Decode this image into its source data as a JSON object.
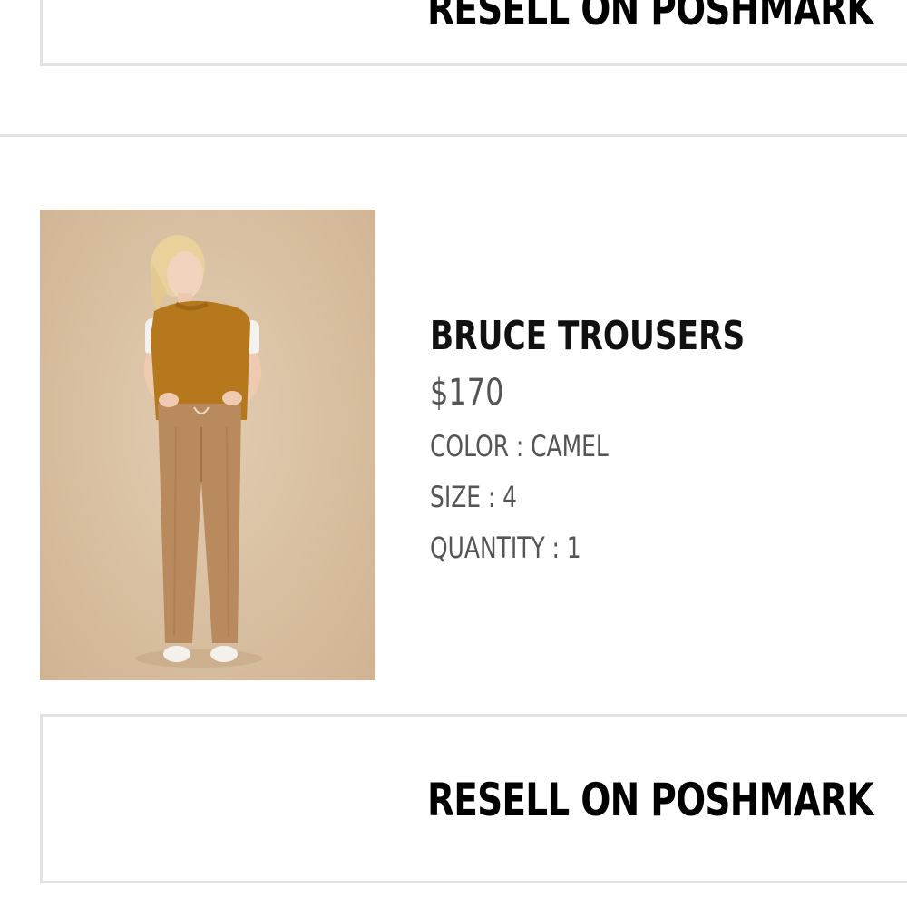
{
  "top_button": {
    "label": "RESELL ON POSHMARK"
  },
  "product": {
    "image_alt": "BRUCE TROUSERS",
    "title": "BRUCE TROUSERS",
    "price": "$170",
    "attributes": [
      {
        "label": "COLOR",
        "value": "CAMEL"
      },
      {
        "label": "SIZE",
        "value": "4"
      },
      {
        "label": "QUANTITY",
        "value": "1"
      }
    ],
    "separator": ":"
  },
  "bottom_button": {
    "label": "RESELL ON POSHMARK"
  },
  "colors": {
    "border": "#e3e3e3",
    "title_text": "#111111",
    "secondary_text": "#555555",
    "image_background": "#d8bfa1",
    "sweater": "#b5781d",
    "trousers": "#b98a5e"
  }
}
